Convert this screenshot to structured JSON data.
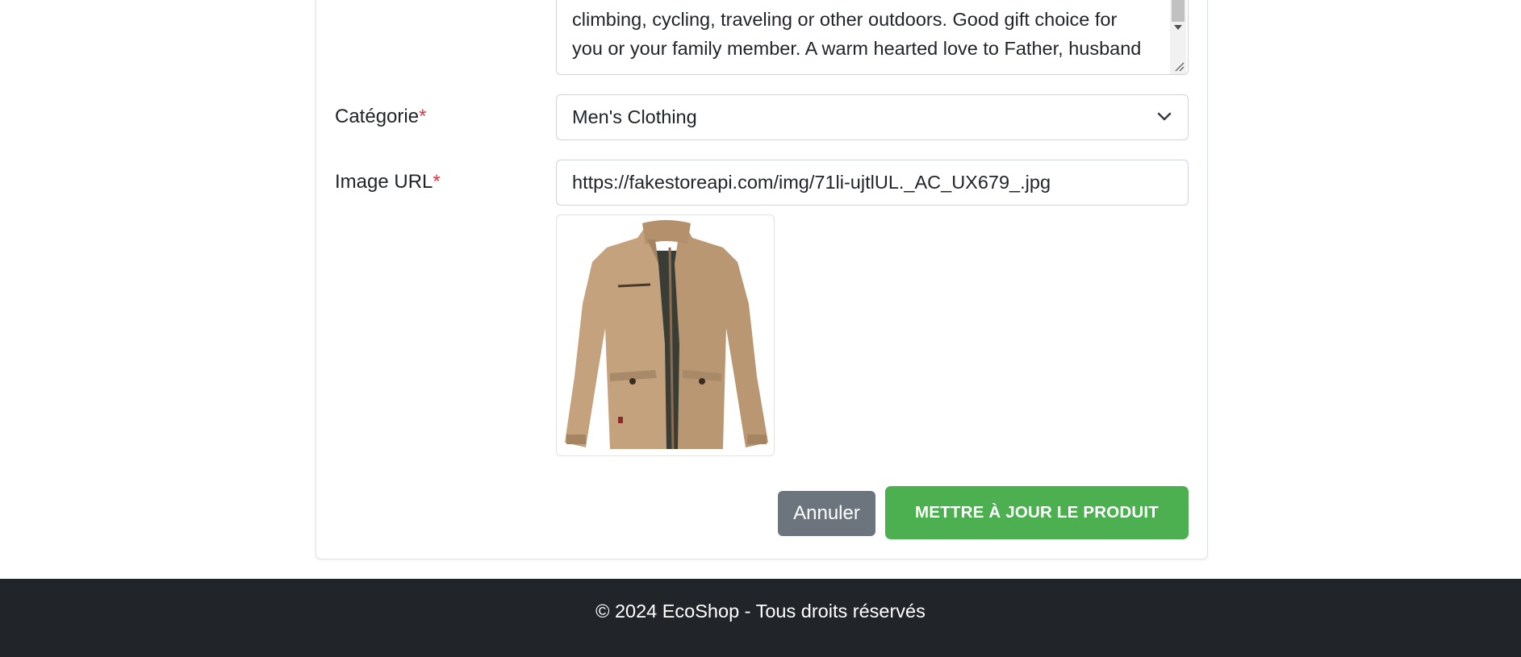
{
  "form": {
    "description_text": "occasions, such as working, hiking, camping, mountain/rock\nclimbing, cycling, traveling or other outdoors. Good gift choice for\nyou or your family member. A warm hearted love to Father, husband",
    "category": {
      "label": "Catégorie",
      "required_mark": "*",
      "selected": "Men's Clothing"
    },
    "image_url": {
      "label": "Image URL",
      "required_mark": "*",
      "value": "https://fakestoreapi.com/img/71li-ujtlUL._AC_UX679_.jpg"
    },
    "preview_icon": "jacket-image",
    "buttons": {
      "cancel": "Annuler",
      "update": "METTRE À JOUR LE PRODUIT"
    }
  },
  "colors": {
    "required": "#dc3545",
    "cancel_button": "#6c757d",
    "update_button": "#4caf50",
    "footer_bg": "#212529"
  },
  "footer": {
    "text": "© 2024 EcoShop - Tous droits réservés"
  }
}
